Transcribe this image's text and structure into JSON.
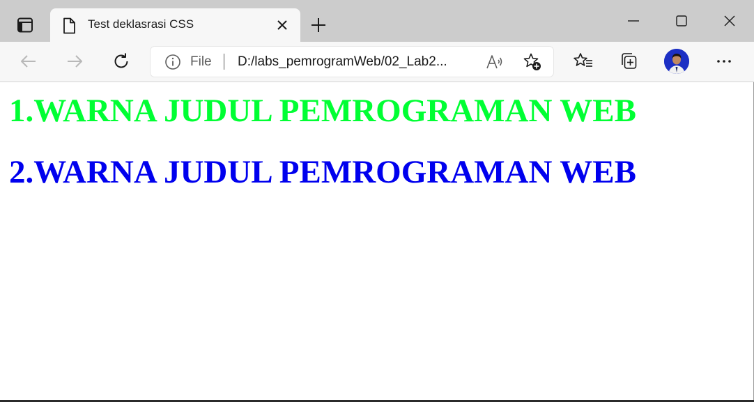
{
  "browser": {
    "tab": {
      "title": "Test deklasrasi CSS"
    },
    "address_bar": {
      "scheme_label": "File",
      "url": "D:/labs_pemrogramWeb/02_Lab2..."
    },
    "icons": {
      "tab_actions": "tab-actions-icon",
      "page": "page-icon",
      "close_tab": "close-icon",
      "new_tab": "plus-icon",
      "minimize": "minimize-icon",
      "maximize": "maximize-icon",
      "close_window": "close-icon",
      "back": "back-arrow-icon",
      "forward": "forward-arrow-icon",
      "refresh": "refresh-icon",
      "info": "info-icon",
      "read_aloud": "read-aloud-icon",
      "add_favorite": "add-favorite-icon",
      "favorites": "favorites-icon",
      "collections": "collections-icon",
      "profile": "avatar",
      "more": "more-icon"
    }
  },
  "page": {
    "headings": [
      {
        "text": "1.WARNA JUDUL PEMROGRAMAN WEB",
        "color": "#00ff33"
      },
      {
        "text": "2.WARNA JUDUL PEMROGRAMAN WEB",
        "color": "#0000ee"
      }
    ]
  }
}
